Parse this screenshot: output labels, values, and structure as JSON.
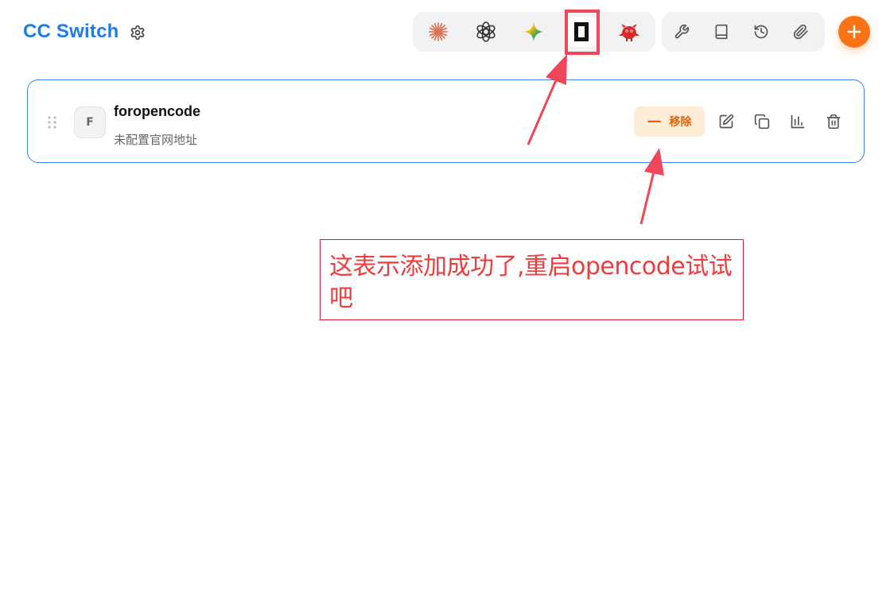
{
  "header": {
    "title": "CC Switch"
  },
  "app_switcher": {
    "apps": [
      {
        "icon": "claude-starburst-icon",
        "color": "#d97757"
      },
      {
        "icon": "openai-knot-icon",
        "color": "#333333"
      },
      {
        "icon": "gemini-sparkle-icon",
        "color": "#4f8ef7"
      },
      {
        "icon": "opencode-square-icon",
        "color": "#111111",
        "active": true
      },
      {
        "icon": "red-bird-icon",
        "color": "#d92b2b"
      }
    ]
  },
  "tools": {
    "items": [
      {
        "icon": "wrench-icon"
      },
      {
        "icon": "book-icon"
      },
      {
        "icon": "history-icon"
      },
      {
        "icon": "paperclip-icon"
      }
    ]
  },
  "add_button": {
    "icon": "plus-icon",
    "color": "#f97316"
  },
  "provider": {
    "avatar_letter": "F",
    "name": "foropencode",
    "subtitle": "未配置官网地址",
    "remove_label": "移除",
    "actions": [
      {
        "icon": "edit-icon"
      },
      {
        "icon": "copy-icon"
      },
      {
        "icon": "chart-icon"
      },
      {
        "icon": "trash-icon"
      }
    ]
  },
  "annotation": {
    "note": "这表示添加成功了,重启opencode试试吧",
    "color": "#ee3b3b"
  }
}
